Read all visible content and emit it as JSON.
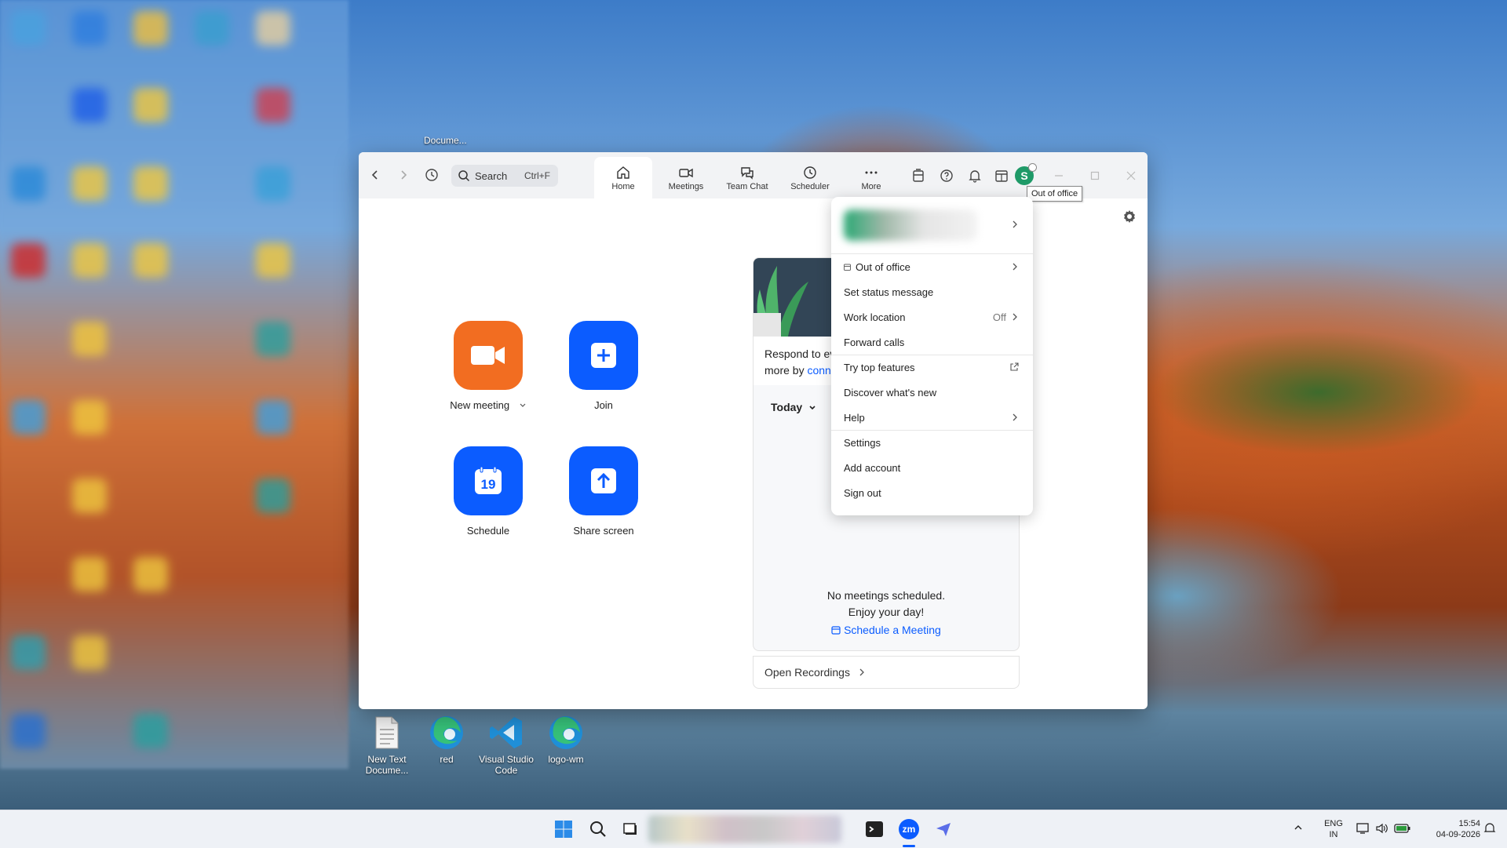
{
  "desktop": {
    "icons": [
      {
        "label": "New Text\nDocume...",
        "name": "new-text-document"
      },
      {
        "label": "red",
        "name": "edge-red"
      },
      {
        "label": "Visual Studio\nCode",
        "name": "vscode"
      },
      {
        "label": "logo-wm",
        "name": "edge-logo-wm"
      }
    ],
    "top_label": "Docume..."
  },
  "zoom": {
    "search": {
      "label": "Search",
      "shortcut": "Ctrl+F"
    },
    "tabs": [
      {
        "label": "Home",
        "active": true
      },
      {
        "label": "Meetings"
      },
      {
        "label": "Team Chat"
      },
      {
        "label": "Scheduler"
      },
      {
        "label": "More"
      }
    ],
    "avatar_letter": "S",
    "tooltip": "Out of office",
    "actions": [
      {
        "label": "New meeting",
        "color": "#f26d21"
      },
      {
        "label": "Join",
        "color": "#0b5cff"
      },
      {
        "label": "Schedule",
        "color": "#0b5cff",
        "calendar_day": "19"
      },
      {
        "label": "Share screen",
        "color": "#0b5cff"
      }
    ],
    "card": {
      "promo_line1": "Respond to ev",
      "promo_line2_prefix": "more by ",
      "promo_line2_link": "conn",
      "today_label": "Today",
      "empty_line1": "No meetings scheduled.",
      "empty_line2": "Enjoy your day!",
      "schedule_link": "Schedule a Meeting",
      "open_recordings": "Open Recordings"
    },
    "menu": {
      "items": [
        {
          "label": "Out of office",
          "chevron": true
        },
        {
          "label": "Set status message"
        },
        {
          "label": "Work location",
          "value": "Off",
          "chevron": true
        },
        {
          "label": "Forward calls"
        },
        {
          "label": "Try top features",
          "external": true
        },
        {
          "label": "Discover what's new"
        },
        {
          "label": "Help",
          "chevron": true
        },
        {
          "label": "Settings"
        },
        {
          "label": "Add account"
        },
        {
          "label": "Sign out"
        }
      ]
    }
  },
  "taskbar": {
    "lang_top": "ENG",
    "lang_bottom": "IN",
    "time": "15:54",
    "date": "04-09-2026",
    "zoom_label": "zm"
  },
  "colors": {
    "accent": "#0b5cff",
    "orange": "#f26d21",
    "avatar": "#1f9a68"
  }
}
